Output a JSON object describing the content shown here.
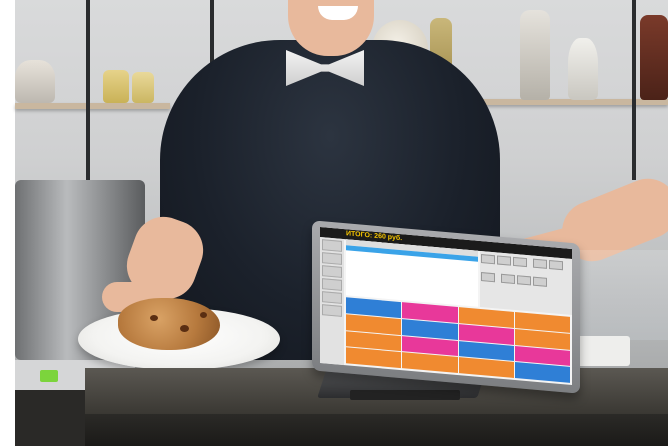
{
  "scene": {
    "description_colors": {
      "shirt": "#1b212b",
      "counter": "#3a3833",
      "pos_accent_orange": "#f08a30",
      "pos_accent_pink": "#e8389a",
      "pos_accent_blue": "#2f7fd6",
      "pos_total_text": "#f5c400"
    }
  },
  "pos": {
    "total_label": "ИТОГО: 260 руб."
  }
}
